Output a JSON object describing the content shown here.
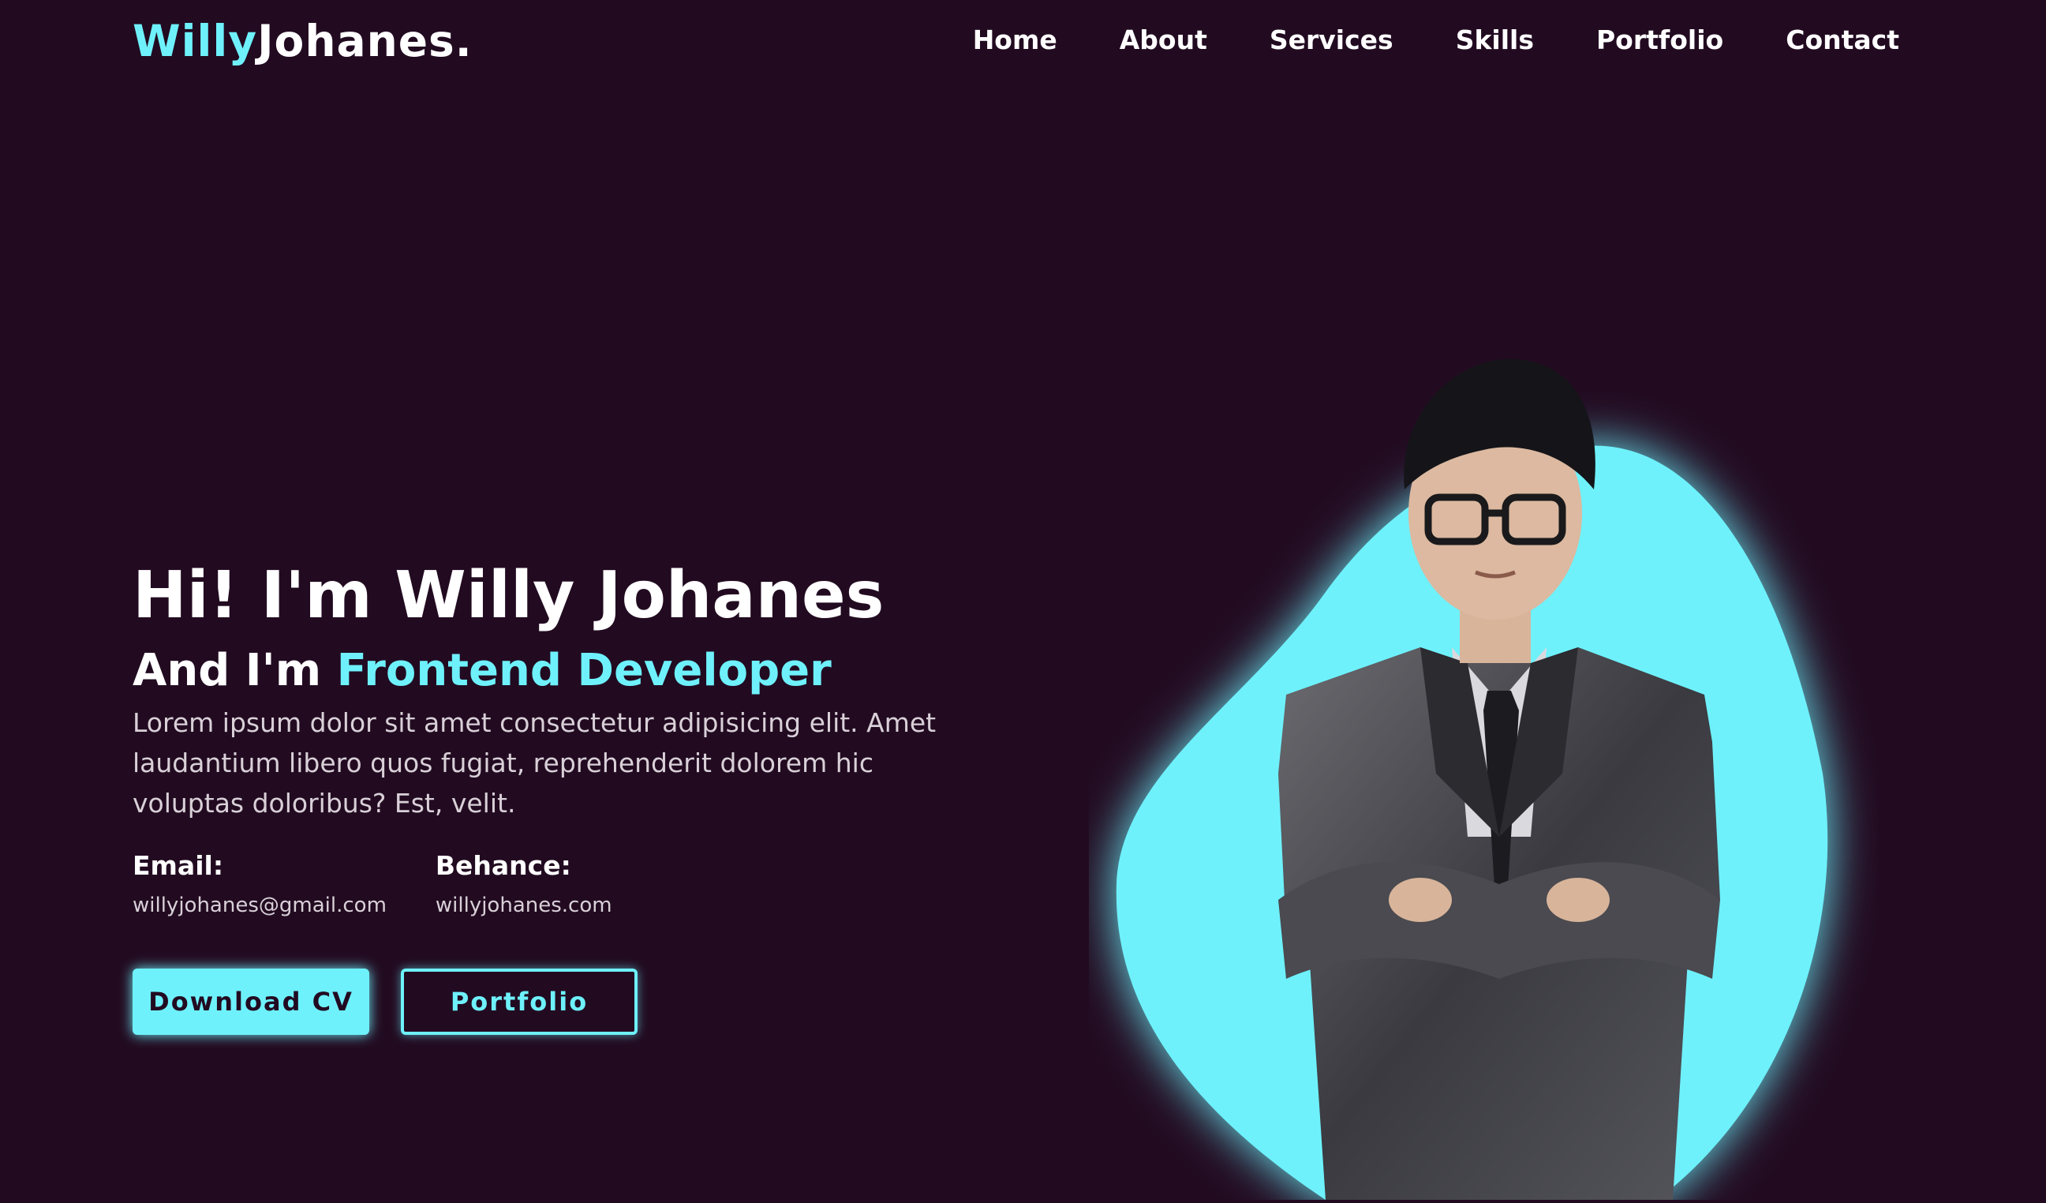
{
  "brand": {
    "first": "Willy",
    "second": "Johanes."
  },
  "nav": {
    "items": [
      "Home",
      "About",
      "Services",
      "Skills",
      "Portfolio",
      "Contact"
    ]
  },
  "hero": {
    "title": "Hi! I'm Willy Johanes",
    "subtitle_prefix": "And I'm",
    "subtitle_role": "Frontend Developer",
    "description": "Lorem ipsum dolor sit amet consectetur adipisicing elit. Amet laudantium libero quos fugiat, reprehenderit dolorem hic voluptas doloribus? Est, velit.",
    "email_label": "Email:",
    "email_value": "willyjohanes@gmail.com",
    "behance_label": "Behance:",
    "behance_value": "willyjohanes.com",
    "download_cv_label": "Download CV",
    "portfolio_label": "Portfolio"
  },
  "colors": {
    "background": "#220b21",
    "accent": "#6ef1fb",
    "text": "#ffffff"
  }
}
